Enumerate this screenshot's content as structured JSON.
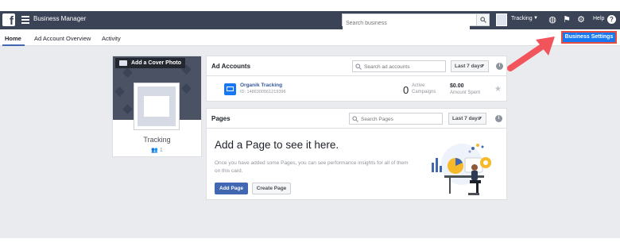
{
  "topbar": {
    "app_title": "Business Manager",
    "search_placeholder": "Search business",
    "account_name": "Tracking",
    "help_label": "Help"
  },
  "icons": {
    "logo": "facebook-logo-icon",
    "menu": "hamburger-menu-icon",
    "search": "search-icon",
    "globe": "globe-icon",
    "flag": "flag-icon",
    "settings": "gear-icon",
    "help": "help-icon"
  },
  "nav": {
    "tabs": [
      "Home",
      "Ad Account Overview",
      "Activity"
    ],
    "active_tab": "Home",
    "business_settings_label": "Business Settings"
  },
  "profile": {
    "cover_label": "Add a Cover Photo",
    "name": "Tracking",
    "people_count": "1"
  },
  "ad_accounts": {
    "title": "Ad Accounts",
    "search_placeholder": "Search ad accounts",
    "range_label": "Last 7 days",
    "account": {
      "name": "Organik Tracking",
      "id_text": "ID: 1486300561219396",
      "active_count": "0",
      "active_label_1": "Active",
      "active_label_2": "Campaigns",
      "spend_value": "$0.00",
      "spend_label": "Amount Spent"
    }
  },
  "pages": {
    "title": "Pages",
    "search_placeholder": "Search Pages",
    "range_label": "Last 7 days",
    "headline": "Add a Page to see it here.",
    "description": "Once you have added some Pages, you can see performance insights for all of them on this card.",
    "add_button": "Add Page",
    "create_button": "Create Page"
  },
  "colors": {
    "topbar": "#3b4356",
    "primary": "#4267b2",
    "settings_button": "#1877f2",
    "highlight": "#e74c3c",
    "background": "#e9ebee"
  }
}
